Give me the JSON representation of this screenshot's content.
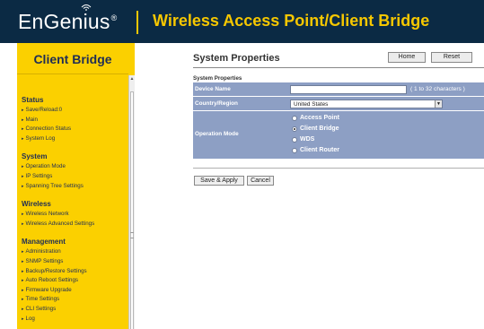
{
  "header": {
    "brand": "EnGenius",
    "brand_mark": "®",
    "title": "Wireless Access Point/Client Bridge"
  },
  "sidebar": {
    "title": "Client Bridge",
    "groups": [
      {
        "heading": "Status",
        "items": [
          "Save/Reload:0",
          "Main",
          "Connection Status",
          "System Log"
        ]
      },
      {
        "heading": "System",
        "items": [
          "Operation Mode",
          "IP Settings",
          "Spanning Tree Settings"
        ]
      },
      {
        "heading": "Wireless",
        "items": [
          "Wireless Network",
          "Wireless Advanced Settings"
        ]
      },
      {
        "heading": "Management",
        "items": [
          "Administration",
          "SNMP Settings",
          "Backup/Restore Settings",
          "Auto Reboot Settings",
          "Firmware Upgrade",
          "Time Settings",
          "CLI Settings",
          "Log"
        ]
      }
    ]
  },
  "main": {
    "page_title": "System Properties",
    "home_button": "Home",
    "reset_button": "Reset",
    "section_label": "System Properties",
    "device_name": {
      "label": "Device Name",
      "value": "",
      "hint": "( 1 to 32 characters )"
    },
    "country": {
      "label": "Country/Region",
      "selected": "United States"
    },
    "operation_mode": {
      "label": "Operation Mode",
      "options": [
        "Access Point",
        "Client Bridge",
        "WDS",
        "Client Router"
      ],
      "selected": "Client Bridge"
    },
    "save_button": "Save & Apply",
    "cancel_button": "Cancel"
  },
  "colors": {
    "header_bg": "#0b2a44",
    "accent_yellow": "#fbd000",
    "table_row": "#8d9fc4"
  }
}
